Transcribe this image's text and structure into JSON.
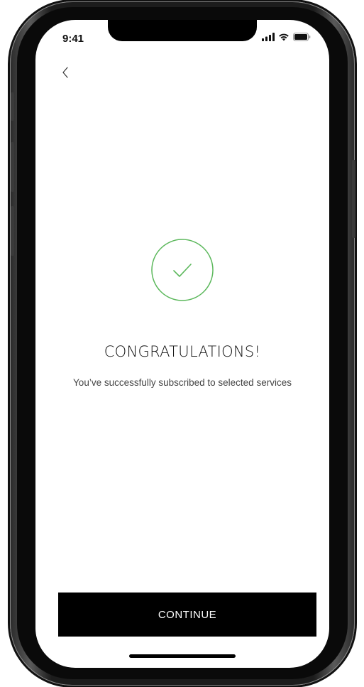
{
  "status_bar": {
    "time": "9:41",
    "icons": [
      "signal-icon",
      "wifi-icon",
      "battery-icon"
    ]
  },
  "nav": {
    "back_icon": "chevron-left-icon"
  },
  "success": {
    "icon": "checkmark-circle-icon",
    "accent_color": "#5cb85c",
    "title": "CONGRATULATIONS!",
    "message": "You’ve successfully subscribed to selected services"
  },
  "actions": {
    "continue_label": "CONTINUE"
  }
}
